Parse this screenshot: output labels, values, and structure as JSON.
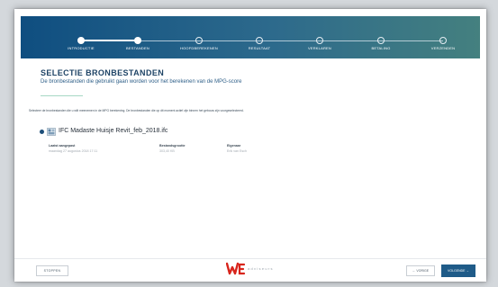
{
  "steps": [
    {
      "label": "INTRODUCTIE",
      "state": "done"
    },
    {
      "label": "BESTANDEN",
      "state": "current"
    },
    {
      "label": "HOOFDBEREKENEN",
      "state": "todo"
    },
    {
      "label": "RESULTAAT",
      "state": "todo"
    },
    {
      "label": "VERKLAREN",
      "state": "todo"
    },
    {
      "label": "BETALING",
      "state": "todo"
    },
    {
      "label": "VERZENDEN",
      "state": "todo"
    }
  ],
  "page": {
    "title": "SELECTIE BRONBESTANDEN",
    "subtitle": "De bronbestanden die gebruikt gaan worden voor het berekenen van de MPG-score",
    "instruction": "Selecteer de bronbestanden die u wilt meenemen in de MPG berekening. De bronbestanden die op dit moment actief zijn binnen het gebouw zijn voorgeselecteerd."
  },
  "file": {
    "name": "IFC Madaste Huisje Revit_feb_2018.ifc",
    "last_modified_label": "Laatst aangepast",
    "last_modified_value": "maandag 27 augustus 2018 17:11",
    "size_label": "Bestandsgrootte",
    "size_value": "303,40 KB",
    "owner_label": "Eigenaar",
    "owner_value": "Erik van Esch"
  },
  "footer": {
    "stop_label": "STOPPEN",
    "logo_text": "adviseurs",
    "back_label": "VORIGE",
    "next_label": "VOLGENDE"
  },
  "colors": {
    "header_start": "#0f4e80",
    "header_end": "#44807f",
    "title": "#1f4466",
    "primary_button": "#1f5b88",
    "logo_red": "#d8251c"
  }
}
